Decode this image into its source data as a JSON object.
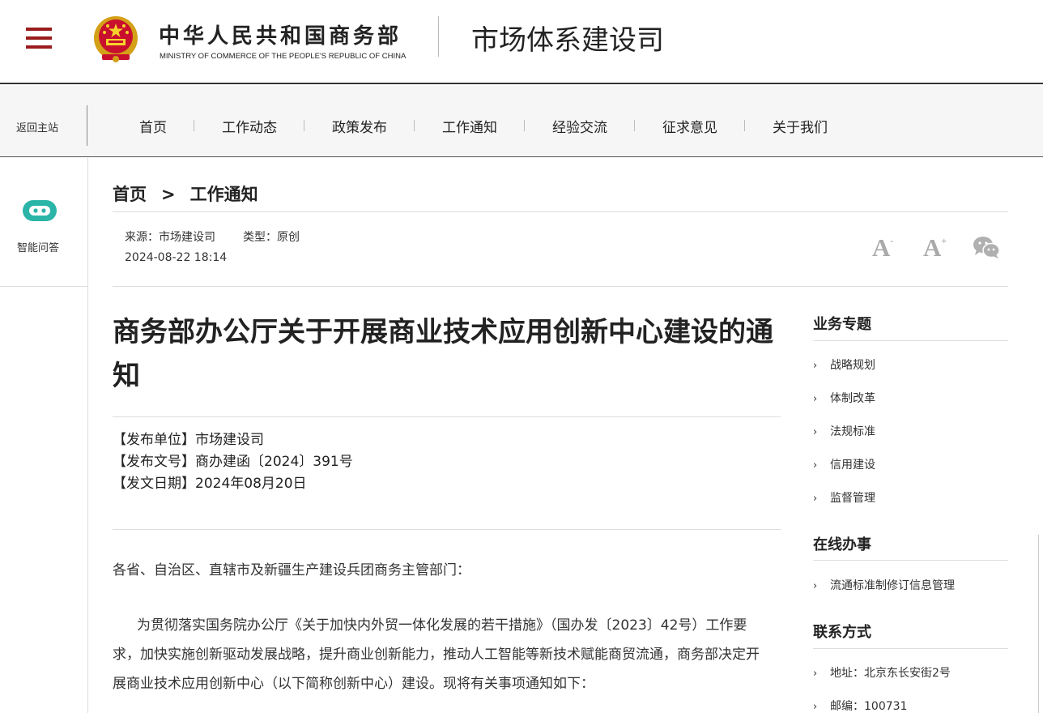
{
  "header": {
    "org_cn": "中华人民共和国商务部",
    "org_en": "MINISTRY OF COMMERCE OF THE PEOPLE'S REPUBLIC OF CHINA",
    "dept_title": "市场体系建设司",
    "accent_color": "#9b1c1c"
  },
  "nav": {
    "back_home": "返回主站",
    "items": [
      "首页",
      "工作动态",
      "政策发布",
      "工作通知",
      "经验交流",
      "征求意见",
      "关于我们"
    ]
  },
  "left": {
    "qa_label": "智能问答"
  },
  "breadcrumb": {
    "home": "首页",
    "sep": ">",
    "current": "工作通知"
  },
  "meta": {
    "source": "来源：市场建设司",
    "type": "类型：原创",
    "datetime": "2024-08-22 18:14"
  },
  "tools": {
    "font_smaller": "A",
    "font_smaller_sign": "-",
    "font_larger": "A",
    "font_larger_sign": "+"
  },
  "article": {
    "title": "商务部办公厅关于开展商业技术应用创新中心建设的通知",
    "info": [
      "【发布单位】市场建设司",
      "【发布文号】商办建函〔2024〕391号",
      "【发文日期】2024年08月20日"
    ],
    "greeting": "各省、自治区、直辖市及新疆生产建设兵团商务主管部门：",
    "paragraph": "为贯彻落实国务院办公厅《关于加快内外贸一体化发展的若干措施》（国办发〔2023〕42号）工作要求，加快实施创新驱动发展战略，提升商业创新能力，推动人工智能等新技术赋能商贸流通，商务部决定开展商业技术应用创新中心（以下简称创新中心）建设。现将有关事项通知如下："
  },
  "sidebar": {
    "topics_title": "业务专题",
    "topics": [
      "战略规划",
      "体制改革",
      "法规标准",
      "信用建设",
      "监督管理"
    ],
    "online_title": "在线办事",
    "online": [
      "流通标准制修订信息管理"
    ],
    "contact_title": "联系方式",
    "contact": [
      "地址：北京东长安街2号",
      "邮编：100731"
    ]
  }
}
